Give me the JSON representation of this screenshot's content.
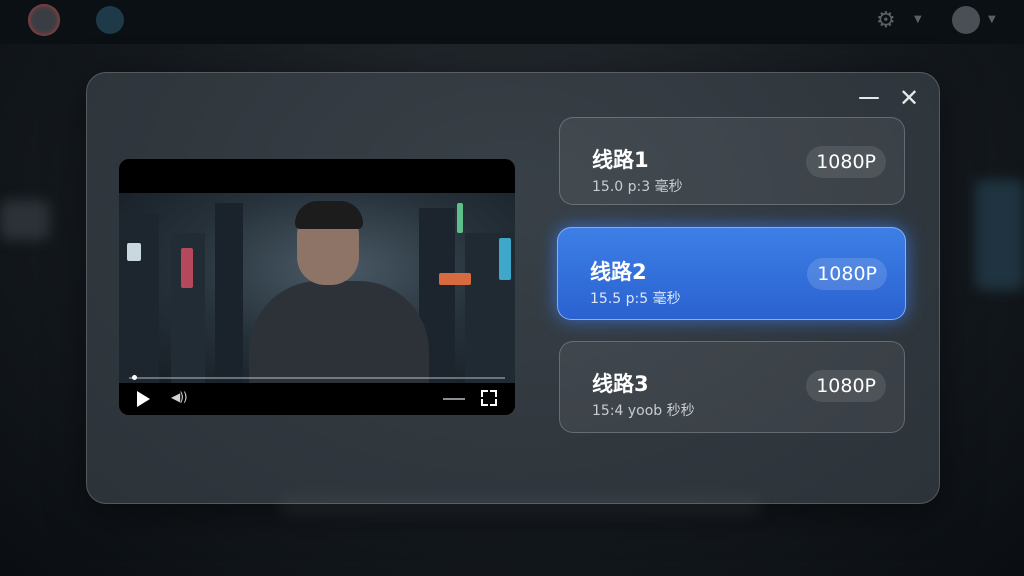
{
  "window": {
    "minimize_icon": "minimize-icon",
    "close_symbol": "✕"
  },
  "player": {
    "progress": 0.01,
    "play_icon": "play-icon",
    "volume_icon": "volume-icon",
    "fullscreen_icon": "fullscreen-icon"
  },
  "routes": [
    {
      "name": "线路1",
      "latency": "15.0 p:3 毫秒",
      "resolution": "1080P",
      "selected": false
    },
    {
      "name": "线路2",
      "latency": "15.5 p:5 毫秒",
      "resolution": "1080P",
      "selected": true
    },
    {
      "name": "线路3",
      "latency": "15:4 yoob 秒秒",
      "resolution": "1080P",
      "selected": false
    }
  ],
  "colors": {
    "accent": "#2f6fe0",
    "dialog_bg": "#464e56"
  }
}
